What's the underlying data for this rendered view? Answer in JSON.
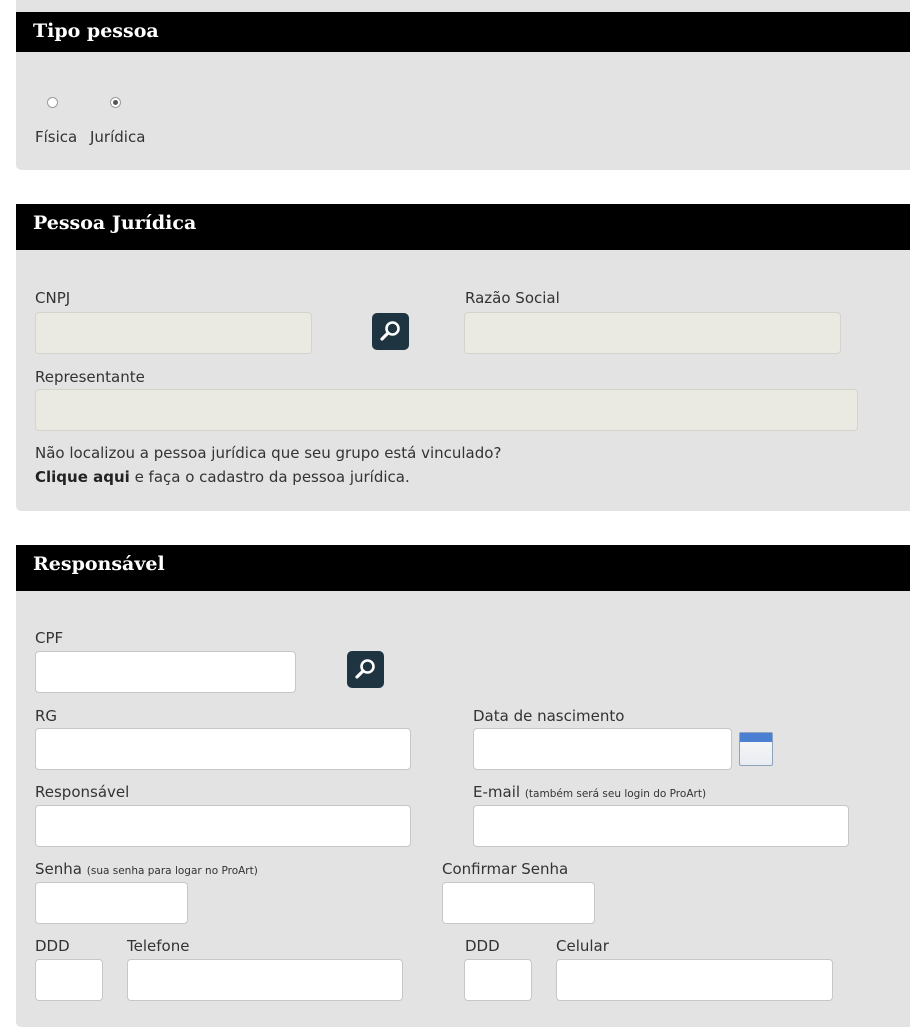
{
  "tipo_pessoa": {
    "title": "Tipo pessoa",
    "options": [
      {
        "label": "Física",
        "selected": false
      },
      {
        "label": "Jurídica",
        "selected": true
      }
    ]
  },
  "pessoa_juridica": {
    "title": "Pessoa Jurídica",
    "cnpj_label": "CNPJ",
    "cnpj_value": "",
    "razao_label": "Razão Social",
    "razao_value": "",
    "representante_label": "Representante",
    "representante_value": "",
    "note_line1": "Não localizou a pessoa jurídica que seu grupo está vinculado?",
    "note_link": "Clique aqui",
    "note_rest": " e faça o cadastro da pessoa jurídica."
  },
  "responsavel": {
    "title": "Responsável",
    "cpf_label": "CPF",
    "rg_label": "RG",
    "nascimento_label": "Data de nascimento",
    "responsavel_label": "Responsável",
    "email_label": "E-mail",
    "email_hint": "(também será seu login do ProArt)",
    "senha_label": "Senha",
    "senha_hint": "(sua senha para logar no ProArt)",
    "confirmar_label": "Confirmar Senha",
    "ddd_label": "DDD",
    "telefone_label": "Telefone",
    "ddd2_label": "DDD",
    "celular_label": "Celular"
  },
  "icons": {
    "search": "magnifier-icon",
    "calendar": "calendar-icon"
  },
  "colors": {
    "header_bg": "#000000",
    "panel_bg": "#e3e3e3",
    "readonly_input": "#eaeae2",
    "search_button": "#1f3441"
  }
}
